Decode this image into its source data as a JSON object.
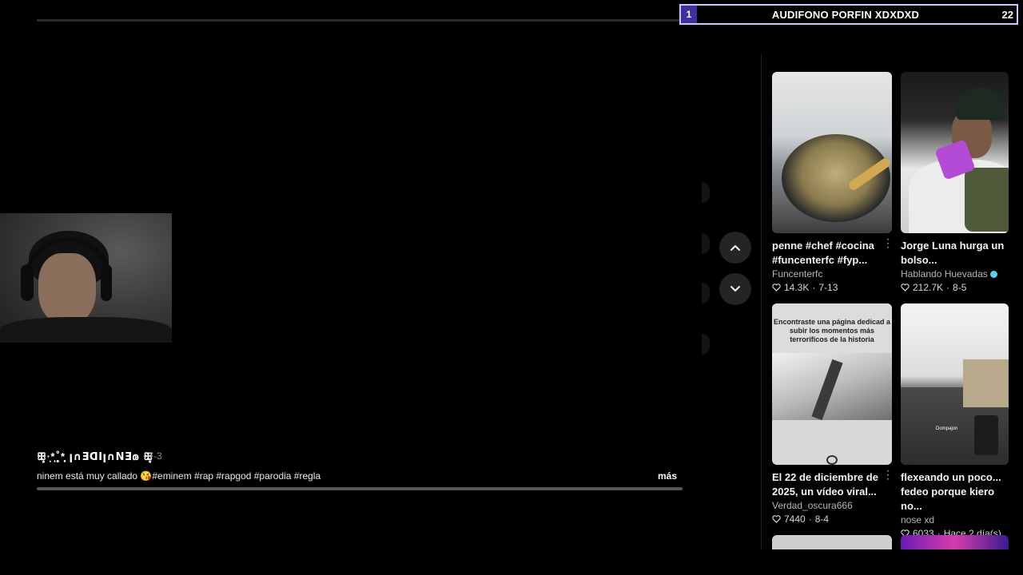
{
  "banner": {
    "index": "1",
    "title": "AUDIFONO PORFIN XDXDXD",
    "count": "22",
    "accent": "#3d2f9e"
  },
  "video": {
    "author": "ꕥ͙·͙*̩̩͙˚̩̥̩̥*̩̩̥͙ ꞁ∩ƎᗡIꞁ∩NƎ𐑀 ꕥ͙",
    "date": "· 7-3",
    "caption": "ninem está muy callado 😘#eminem #rap #rapgod #parodia #regla",
    "more": "más"
  },
  "nav": {
    "up_icon": "chevron-up-icon",
    "down_icon": "chevron-down-icon"
  },
  "recommendations": [
    {
      "title": "penne #chef #cocina #funcenterfc #fyp...",
      "channel": "Funcenterfc",
      "likes": "14.3K",
      "date": "7-13",
      "verified": false
    },
    {
      "title": "Jorge Luna hurga un bolso...",
      "channel": "Hablando Huevadas",
      "likes": "212.7K",
      "date": "8-5",
      "verified": true
    },
    {
      "title": "El 22 de diciembre de 2025, un vídeo viral...",
      "channel": "Verdad_oscura666",
      "likes": "7440",
      "date": "8-4",
      "verified": false,
      "thumb_text": "Encontraste una página dedicad a subir los momentos más terroríficos de la historia"
    },
    {
      "title": "flexeando un poco... fedeo porque kiero no...",
      "channel": "nose xd",
      "likes": "6033",
      "date": "Hace 2 día(s)",
      "verified": false,
      "thumb_label": "Dompajon"
    }
  ],
  "separator": "·"
}
